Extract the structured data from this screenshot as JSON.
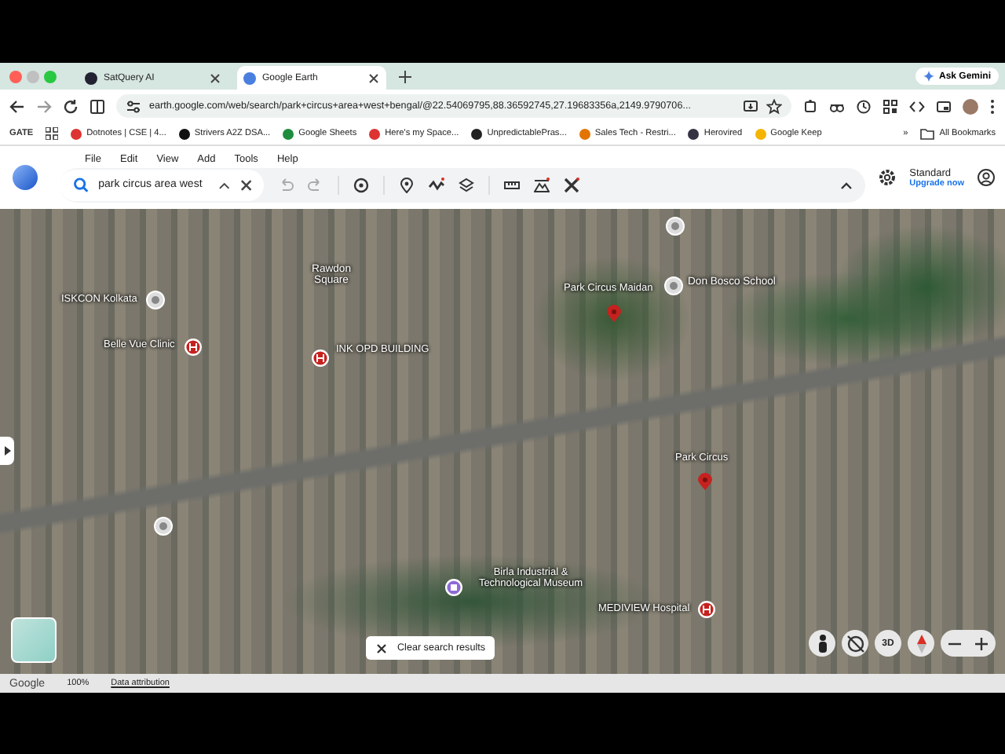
{
  "browser": {
    "tabs": [
      {
        "title": "SatQuery AI",
        "selected": false
      },
      {
        "title": "Google Earth",
        "selected": true
      }
    ],
    "ask_gemini": "Ask Gemini",
    "address": "earth.google.com/web/search/park+circus+area+west+bengal/@22.54069795,88.36592745,27.19683356a,2149.9790706...",
    "bookmarks": [
      {
        "label": "GATE",
        "kind": "text"
      },
      {
        "label": "Dotnotes | CSE | 4...",
        "kind": "site"
      },
      {
        "label": "Strivers A2Z DSA...",
        "kind": "site"
      },
      {
        "label": "Google Sheets",
        "kind": "site"
      },
      {
        "label": "Here's my Space...",
        "kind": "site"
      },
      {
        "label": "UnpredictablePras...",
        "kind": "site"
      },
      {
        "label": "Sales Tech - Restri...",
        "kind": "site"
      },
      {
        "label": "Herovired",
        "kind": "site"
      },
      {
        "label": "Google Keep",
        "kind": "site"
      }
    ],
    "more": "»",
    "all_bookmarks": "All Bookmarks"
  },
  "app": {
    "menu": [
      "File",
      "Edit",
      "View",
      "Add",
      "Tools",
      "Help"
    ],
    "search": {
      "value": "park circus area west"
    },
    "plan": "Standard",
    "upgrade": "Upgrade now"
  },
  "map": {
    "labels": [
      {
        "text": "Rawdon Square",
        "kind": "place"
      },
      {
        "text": "ISKCON Kolkata",
        "kind": "pin"
      },
      {
        "text": "Belle Vue Clinic",
        "kind": "hospital"
      },
      {
        "text": "INK OPD BUILDING",
        "kind": "hospital"
      },
      {
        "text": "Park Circus Maidan",
        "kind": "pin"
      },
      {
        "text": "Don Bosco School",
        "kind": "place"
      },
      {
        "text": "Park Circus",
        "kind": "search"
      },
      {
        "text": "Birla Industrial & Technological Museum",
        "kind": "museum"
      },
      {
        "text": "MEDIVIEW Hospital",
        "kind": "hospital"
      }
    ],
    "clear_button": "Clear search results",
    "three_d": "3D"
  },
  "footer": {
    "brand": "Google",
    "zoom": "100%",
    "attribution": "Data attribution"
  }
}
